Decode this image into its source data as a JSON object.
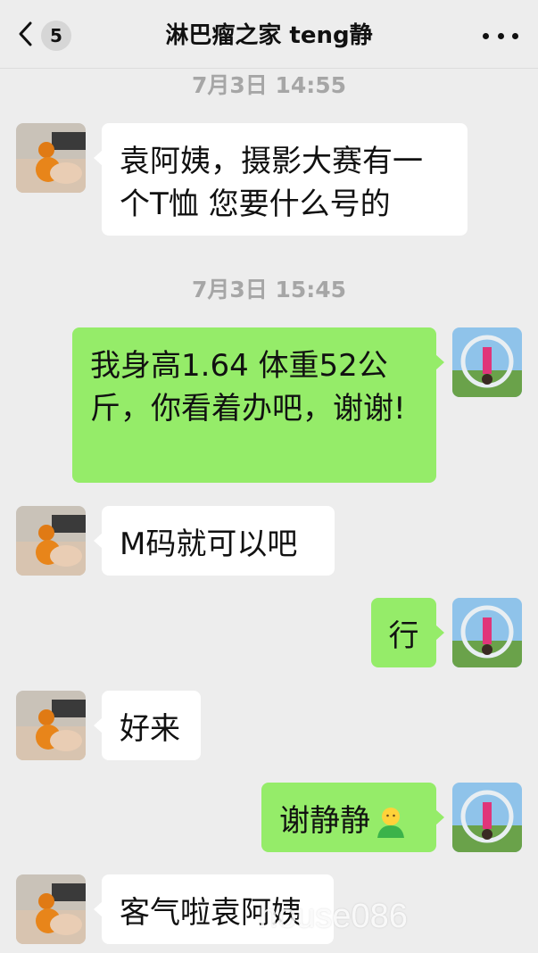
{
  "header": {
    "back_badge": "5",
    "title": "淋巴瘤之家 teng静"
  },
  "timestamps": [
    "7月3日 14:55",
    "7月3日 15:45"
  ],
  "messages": [
    {
      "side": "in",
      "text": "袁阿姨，摄影大赛有一个T恤 您要什么号的"
    },
    {
      "side": "out",
      "text": "我身高1.64 体重52公斤，你看着办吧，谢谢!"
    },
    {
      "side": "in",
      "text": "M码就可以吧"
    },
    {
      "side": "out",
      "text": "行"
    },
    {
      "side": "in",
      "text": "好来"
    },
    {
      "side": "out",
      "text": "谢静静"
    },
    {
      "side": "in",
      "text": "客气啦袁阿姨"
    }
  ],
  "watermark": "house086",
  "colors": {
    "background": "#ededed",
    "incoming_bubble": "#ffffff",
    "outgoing_bubble": "#95ec69"
  },
  "icons": {
    "back": "chevron-left-icon",
    "more": "ellipsis-icon",
    "emoji": "person-emoji-icon"
  }
}
